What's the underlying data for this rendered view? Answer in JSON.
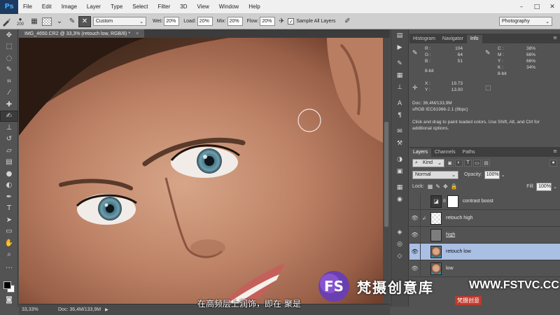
{
  "app": {
    "logo": "Ps"
  },
  "menu": [
    "File",
    "Edit",
    "Image",
    "Layer",
    "Type",
    "Select",
    "Filter",
    "3D",
    "View",
    "Window",
    "Help"
  ],
  "window_controls": [
    "–",
    "□",
    "✕"
  ],
  "options_bar": {
    "brush_size": "200",
    "brush_preset": "Custom",
    "wet_label": "Wet:",
    "wet_value": "20%",
    "load_label": "Load:",
    "load_value": "20%",
    "mix_label": "Mix:",
    "mix_value": "20%",
    "flow_label": "Flow:",
    "flow_value": "20%",
    "sample_all_label": "Sample All Layers",
    "sample_all_checked": true,
    "workspace": "Photography"
  },
  "document": {
    "tab_title": "IMG_4650.CR2 @ 33,3% (retouch low, RGB/8) *",
    "close": "×"
  },
  "status": {
    "zoom": "33,33%",
    "doc_size": "Doc: 36,4M/133,9M"
  },
  "info_panel": {
    "tabs": [
      "Histogram",
      "Navigator",
      "Info"
    ],
    "active_tab": "Info",
    "rgb": {
      "R": "104",
      "G": "64",
      "B": "51"
    },
    "rgb_bits": "8-bit",
    "cmyk": {
      "C": "38%",
      "M": "66%",
      "Y": "66%",
      "K": "34%"
    },
    "cmyk_bits": "8-bit",
    "X": "19.73",
    "Y": "13.00",
    "doc": "Doc: 36,4M/133,9M",
    "profile": "sRGB IEC61966-2.1 (8bpc)",
    "hint": "Click and drag to paint loaded colors.  Use Shift, Alt, and Ctrl for additional options."
  },
  "layers_panel": {
    "tabs": [
      "Layers",
      "Channels",
      "Paths"
    ],
    "active_tab": "Layers",
    "kind": "Kind",
    "blend_mode": "Normal",
    "opacity_label": "Opacity:",
    "opacity": "100%",
    "lock_label": "Lock:",
    "fill_label": "Fill:",
    "fill": "100%",
    "layers": [
      {
        "name": "contrast boost",
        "thumb": "adjustment",
        "visible": false,
        "selected": false
      },
      {
        "name": "retouch high",
        "thumb": "transparent",
        "visible": true,
        "selected": false,
        "clipped": true
      },
      {
        "name": "high",
        "thumb": "gray",
        "visible": true,
        "selected": false,
        "underlined": true
      },
      {
        "name": "retouch low",
        "thumb": "face",
        "visible": true,
        "selected": true
      },
      {
        "name": "low",
        "thumb": "face",
        "visible": true,
        "selected": false
      }
    ]
  },
  "watermark": {
    "logo_text": "FS",
    "text": "梵摄创意库",
    "url": "WWW.FSTVC.CC",
    "brand": "梵摄创意"
  },
  "subtitle": "在高频层上润饰，即在 聚是"
}
